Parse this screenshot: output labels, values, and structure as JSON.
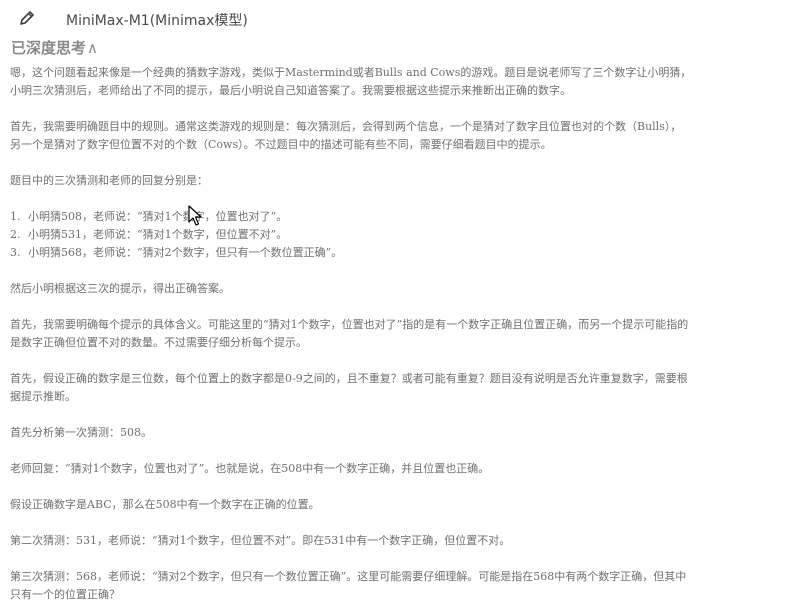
{
  "header": {
    "model_name": "MiniMax-M1(Minimax模型)"
  },
  "thinking": {
    "label": "已深度思考",
    "chevron": "∧"
  },
  "icons": {
    "edit": "pencil-icon",
    "cursor": "mouse-pointer-icon"
  },
  "content": {
    "p1": "嗯，这个问题看起来像是一个经典的猜数字游戏，类似于Mastermind或者Bulls and Cows的游戏。题目是说老师写了三个数字让小明猜，小明三次猜测后，老师给出了不同的提示，最后小明说自己知道答案了。我需要根据这些提示来推断出正确的数字。",
    "p2": "首先，我需要明确题目中的规则。通常这类游戏的规则是：每次猜测后，会得到两个信息，一个是猜对了数字且位置也对的个数（Bulls），另一个是猜对了数字但位置不对的个数（Cows）。不过题目中的描述可能有些不同，需要仔细看题目中的提示。",
    "p3": "题目中的三次猜测和老师的回复分别是：",
    "list": [
      {
        "num": "1.",
        "text": "小明猜508，老师说：“猜对1个数字，位置也对了”。"
      },
      {
        "num": "2.",
        "text": "小明猜531，老师说：“猜对1个数字，但位置不对”。"
      },
      {
        "num": "3.",
        "text": "小明猜568，老师说：“猜对2个数字，但只有一个数位置正确”。"
      }
    ],
    "p4": "然后小明根据这三次的提示，得出正确答案。",
    "p5": "首先，我需要明确每个提示的具体含义。可能这里的“猜对1个数字，位置也对了”指的是有一个数字正确且位置正确，而另一个提示可能指的是数字正确但位置不对的数量。不过需要仔细分析每个提示。",
    "p6": "首先，假设正确的数字是三位数，每个位置上的数字都是0-9之间的，且不重复？或者可能有重复？题目没有说明是否允许重复数字，需要根据提示推断。",
    "p7": "首先分析第一次猜测：508。",
    "p8": "老师回复：“猜对1个数字，位置也对了”。也就是说，在508中有一个数字正确，并且位置也正确。",
    "p9": "假设正确数字是ABC，那么在508中有一个数字在正确的位置。",
    "p10": "第二次猜测：531，老师说：“猜对1个数字，但位置不对”。即在531中有一个数字正确，但位置不对。",
    "p11": "第三次猜测：568，老师说：“猜对2个数字，但只有一个数位置正确”。这里可能需要仔细理解。可能是指在568中有两个数字正确，但其中只有一个的位置正确？"
  }
}
